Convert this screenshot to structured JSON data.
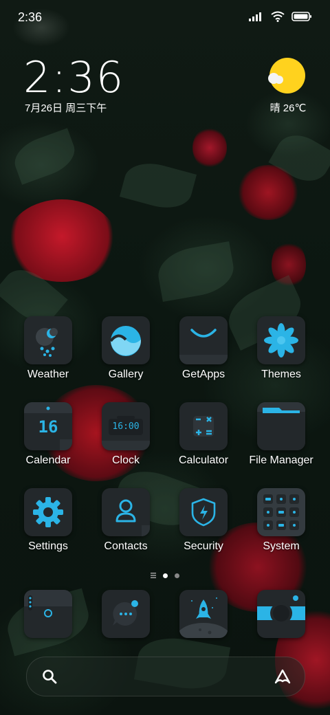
{
  "status_bar": {
    "time": "2:36"
  },
  "clock_widget": {
    "time": "2:36",
    "date": "7月26日 周三下午"
  },
  "weather_widget": {
    "text": "晴 26℃",
    "icon": "sun-cloud-icon"
  },
  "apps": [
    {
      "label": "Weather",
      "icon": "weather-icon"
    },
    {
      "label": "Gallery",
      "icon": "gallery-icon"
    },
    {
      "label": "GetApps",
      "icon": "getapps-icon"
    },
    {
      "label": "Themes",
      "icon": "themes-icon"
    },
    {
      "label": "Calendar",
      "icon": "calendar-icon",
      "badge": "16"
    },
    {
      "label": "Clock",
      "icon": "clock-icon",
      "display": "16:00"
    },
    {
      "label": "Calculator",
      "icon": "calculator-icon"
    },
    {
      "label": "File Manager",
      "icon": "folder-icon"
    },
    {
      "label": "Settings",
      "icon": "gear-icon"
    },
    {
      "label": "Contacts",
      "icon": "person-icon"
    },
    {
      "label": "Security",
      "icon": "shield-icon"
    },
    {
      "label": "System",
      "icon": "folder-grid-icon"
    }
  ],
  "page_indicator": {
    "pages": 2,
    "active": 1
  },
  "dock": [
    {
      "icon": "phone-icon"
    },
    {
      "icon": "messages-icon"
    },
    {
      "icon": "browser-rocket-icon"
    },
    {
      "icon": "camera-icon"
    }
  ],
  "search_bar": {
    "left_icon": "search-icon",
    "right_icon": "assistant-icon"
  },
  "colors": {
    "accent": "#2bb4e6",
    "tile": "#23282b",
    "sun": "#ffd21e"
  }
}
